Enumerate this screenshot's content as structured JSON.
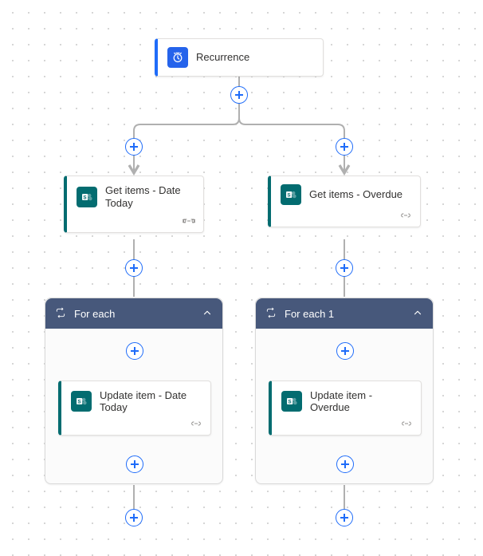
{
  "trigger": {
    "label": "Recurrence"
  },
  "branches": {
    "left": {
      "getItems": {
        "label": "Get items - Date Today"
      },
      "forEach": {
        "label": "For each"
      },
      "update": {
        "label": "Update item - Date Today"
      }
    },
    "right": {
      "getItems": {
        "label": "Get items - Overdue"
      },
      "forEach": {
        "label": "For each 1"
      },
      "update": {
        "label": "Update item - Overdue"
      }
    }
  },
  "colors": {
    "triggerAccent": "#1f6cf9",
    "sharepointAccent": "#036c70",
    "forEachBar": "#47587b"
  }
}
